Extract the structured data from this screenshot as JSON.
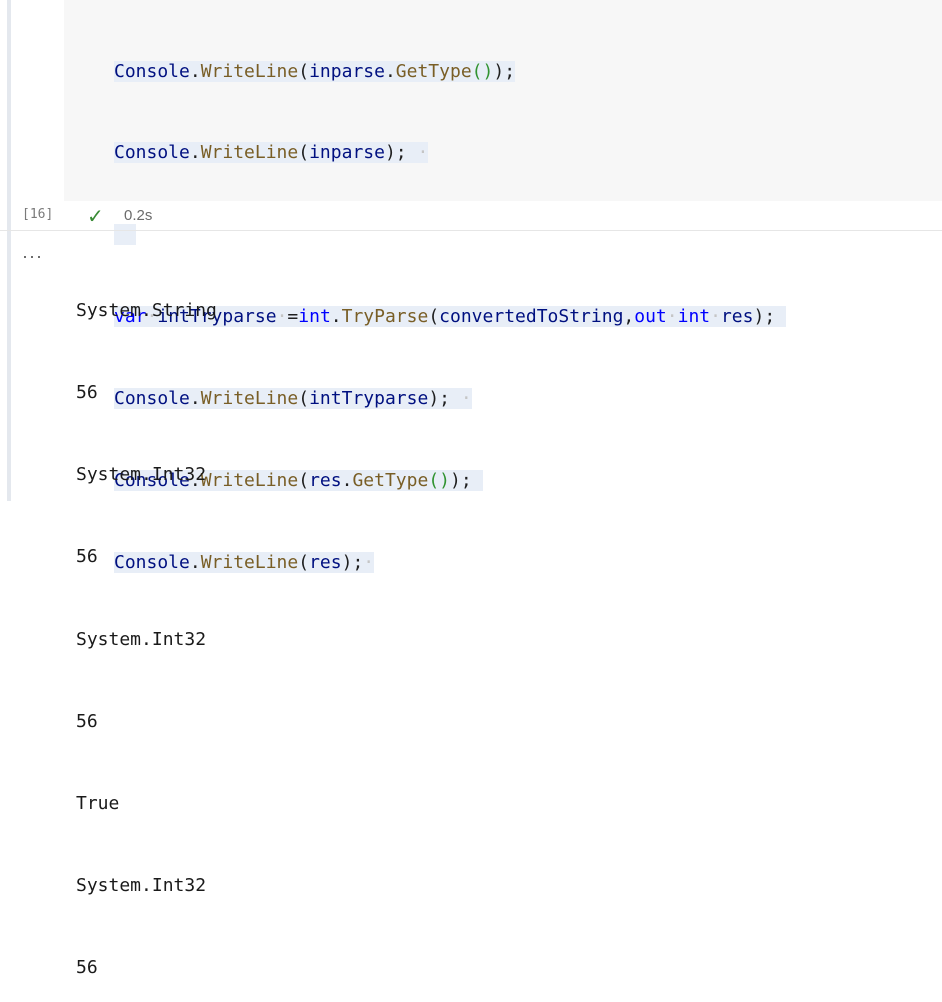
{
  "cell": {
    "execution_count": "[16]",
    "status_time": "0.2s",
    "code_lines": [
      [
        "Console",
        ".",
        "WriteLine",
        "(",
        "inparse",
        ".",
        "GetType",
        "()",
        ")",
        ";"
      ],
      [
        "Console",
        ".",
        "WriteLine",
        "(",
        "inparse",
        ")",
        ";"
      ],
      [],
      [
        "var",
        "intTryparse",
        "=",
        "int",
        ".",
        "TryParse",
        "(",
        "convertedToString",
        ",",
        "out",
        "int",
        "res",
        ")",
        ";"
      ],
      [
        "Console",
        ".",
        "WriteLine",
        "(",
        "intTryparse",
        ")",
        ";"
      ],
      [
        "Console",
        ".",
        "WriteLine",
        "(",
        "res",
        ".",
        "GetType",
        "()",
        ")",
        ";"
      ],
      [
        "Console",
        ".",
        "WriteLine",
        "(",
        "res",
        ")",
        ";"
      ]
    ]
  },
  "output": {
    "menu_label": "···",
    "lines": [
      "System.String",
      "56",
      "System.Int32",
      "56",
      "System.Int32",
      "56",
      "True",
      "System.Int32",
      "56"
    ]
  },
  "colors": {
    "keyword": "#0000ff",
    "method": "#795e26",
    "identifier": "#001080",
    "success": "#388a34"
  },
  "icons": {
    "status": "check-icon",
    "output_menu": "ellipsis-icon"
  }
}
